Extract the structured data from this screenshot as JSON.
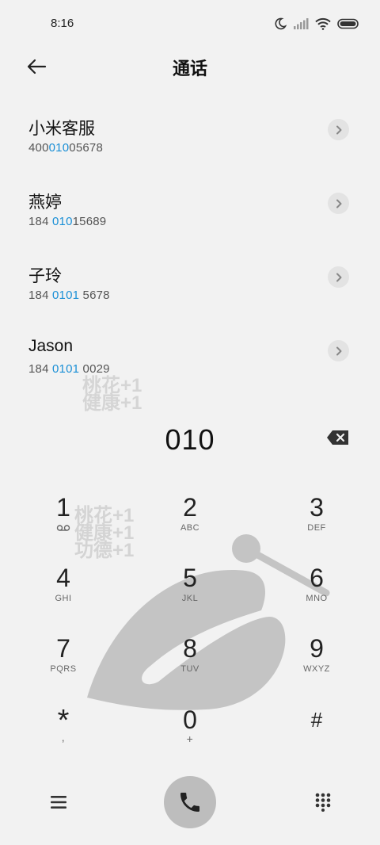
{
  "status": {
    "time": "8:16"
  },
  "header": {
    "title": "通话"
  },
  "contacts": [
    {
      "name": "小米客服",
      "number_pre": "400",
      "number_hl": "010",
      "number_post": "05678"
    },
    {
      "name": "燕婷",
      "number_pre": "184 ",
      "number_hl": "010",
      "number_post": "15689"
    },
    {
      "name": "子玲",
      "number_pre": "184 ",
      "number_hl": "0101",
      "number_post": " 5678"
    },
    {
      "name": "Jason",
      "number_pre": "184 ",
      "number_hl": "0101",
      "number_post": " 0029"
    }
  ],
  "watermark": {
    "line1": "桃花+1",
    "line2": "健康+1",
    "line3": "功德+1"
  },
  "dialer": {
    "number": "010"
  },
  "keys": [
    {
      "digit": "1",
      "letters": ""
    },
    {
      "digit": "2",
      "letters": "ABC"
    },
    {
      "digit": "3",
      "letters": "DEF"
    },
    {
      "digit": "4",
      "letters": "GHI"
    },
    {
      "digit": "5",
      "letters": "JKL"
    },
    {
      "digit": "6",
      "letters": "MNO"
    },
    {
      "digit": "7",
      "letters": "PQRS"
    },
    {
      "digit": "8",
      "letters": "TUV"
    },
    {
      "digit": "9",
      "letters": "WXYZ"
    },
    {
      "digit": "*",
      "letters": ","
    },
    {
      "digit": "0",
      "letters": "+"
    },
    {
      "digit": "#",
      "letters": ""
    }
  ],
  "icons": {
    "back": "back-arrow-icon",
    "chevron": "chevron-right-icon",
    "backspace": "backspace-icon",
    "voicemail": "voicemail-icon",
    "menu": "menu-icon",
    "call": "phone-icon",
    "keypad": "dialpad-icon"
  },
  "colors": {
    "highlight": "#1a8fd6",
    "background": "#f2f2f2",
    "call_button": "#bdbdbd"
  }
}
